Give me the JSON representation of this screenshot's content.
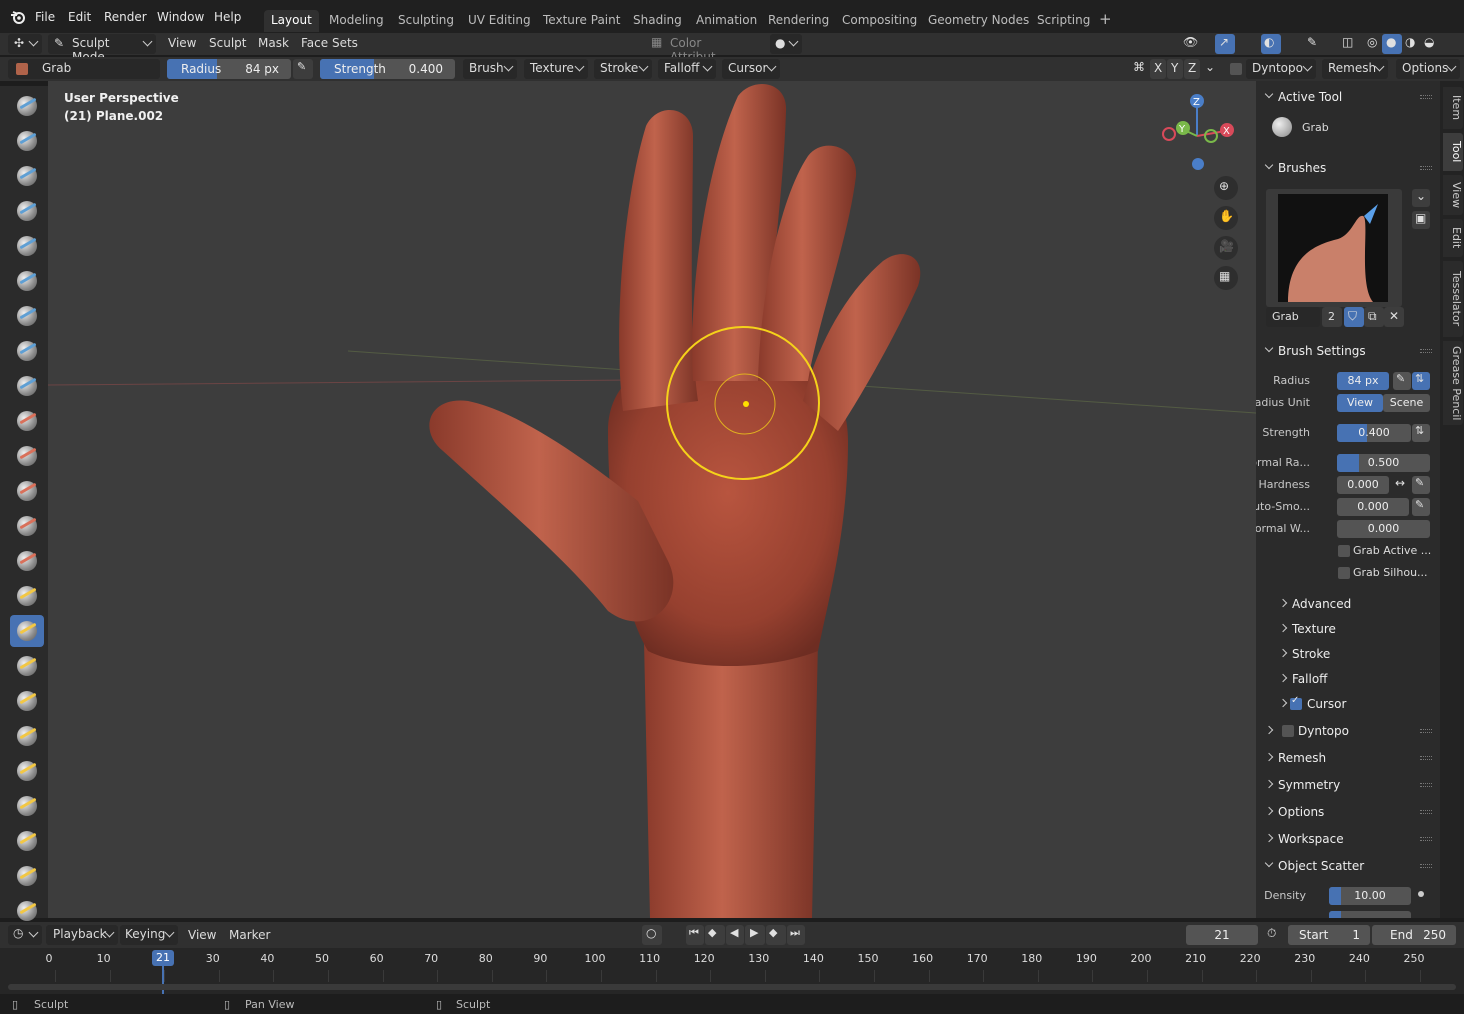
{
  "menubar": {
    "items": [
      "File",
      "Edit",
      "Render",
      "Window",
      "Help"
    ],
    "workspaces": [
      "Layout",
      "Modeling",
      "Sculpting",
      "UV Editing",
      "Texture Paint",
      "Shading",
      "Animation",
      "Rendering",
      "Compositing",
      "Geometry Nodes",
      "Scripting"
    ],
    "active_workspace": "Layout",
    "add_tab": "+"
  },
  "header": {
    "mode": "Sculpt Mode",
    "menus": [
      "View",
      "Sculpt",
      "Mask",
      "Face Sets"
    ],
    "color_attribute": "Color Attribut..."
  },
  "tool_settings": {
    "brush_name": "Grab",
    "radius_label": "Radius",
    "radius_value": "84 px",
    "strength_label": "Strength",
    "strength_value": "0.400",
    "strength_fraction": 0.4,
    "dropdowns": [
      "Brush",
      "Texture",
      "Stroke",
      "Falloff",
      "Cursor"
    ],
    "axes": [
      "X",
      "Y",
      "Z"
    ],
    "dyntopo": "Dyntopo",
    "remesh": "Remesh",
    "options": "Options"
  },
  "viewport": {
    "view_name": "User Perspective",
    "object_name": "(21) Plane.002",
    "gizmo_axes": [
      "X",
      "Y",
      "Z"
    ]
  },
  "sidebar": {
    "active_tool_header": "Active Tool",
    "active_tool_name": "Grab",
    "brushes_header": "Brushes",
    "brush_name": "Grab",
    "brush_users": "2",
    "brush_settings_header": "Brush Settings",
    "radius_label": "Radius",
    "radius_value": "84 px",
    "radius_unit_label": "Radius Unit",
    "radius_unit_view": "View",
    "radius_unit_scene": "Scene",
    "strength_label": "Strength",
    "strength_value": "0.400",
    "strength_fraction": 0.4,
    "normal_radius_label": "Normal Ra...",
    "normal_radius_value": "0.500",
    "hardness_label": "Hardness",
    "hardness_value": "0.000",
    "autosmooth_label": "Auto-Smo...",
    "autosmooth_value": "0.000",
    "normal_weight_label": "Normal W...",
    "normal_weight_value": "0.000",
    "grab_active_label": "Grab Active ...",
    "grab_silhouette_label": "Grab Silhou...",
    "subpanels": [
      "Advanced",
      "Texture",
      "Stroke",
      "Falloff",
      "Cursor"
    ],
    "panels": [
      "Dyntopo",
      "Remesh",
      "Symmetry",
      "Options",
      "Workspace"
    ],
    "object_scatter_header": "Object Scatter",
    "density_label": "Density",
    "density_value": "10.00"
  },
  "right_tabs": [
    "Item",
    "Tool",
    "View",
    "Edit",
    "Tesselator",
    "Grease Pencil"
  ],
  "timeline": {
    "menus": [
      "Playback",
      "Keying",
      "View",
      "Marker"
    ],
    "current_frame": "21",
    "start_label": "Start",
    "start_value": "1",
    "end_label": "End",
    "end_value": "250",
    "ticks": [
      "0",
      "10",
      "20",
      "30",
      "40",
      "50",
      "60",
      "70",
      "80",
      "90",
      "100",
      "110",
      "120",
      "130",
      "140",
      "150",
      "160",
      "170",
      "180",
      "190",
      "200",
      "210",
      "220",
      "230",
      "240",
      "250"
    ]
  },
  "statusbar": {
    "items": [
      "Sculpt",
      "Pan View",
      "Sculpt"
    ]
  }
}
